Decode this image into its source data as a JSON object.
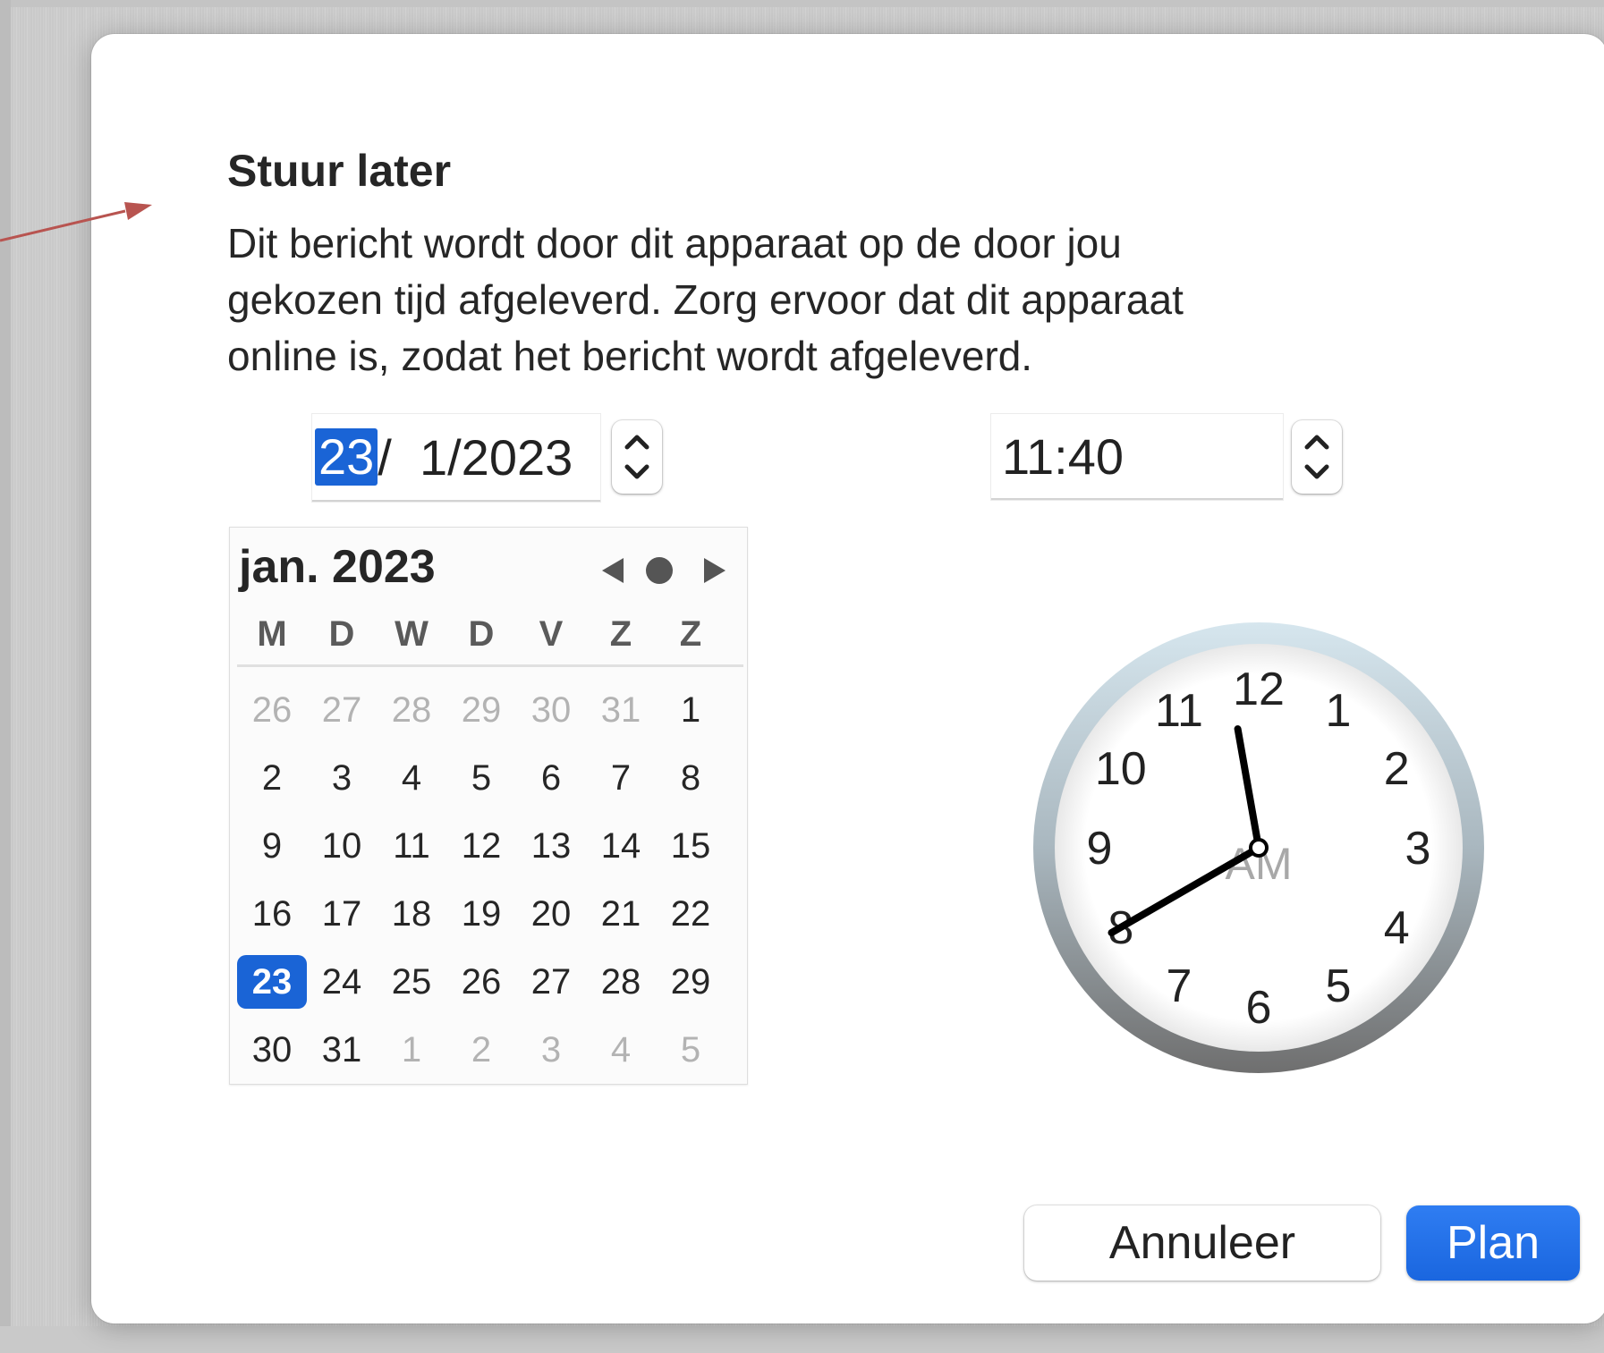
{
  "dialog": {
    "title": "Stuur later",
    "description_lines": [
      "Dit bericht wordt door dit apparaat op de door jou",
      "gekozen tijd afgeleverd. Zorg ervoor dat dit apparaat",
      "online is, zodat het bericht wordt afgeleverd."
    ]
  },
  "date_field": {
    "day": "23",
    "rest": "/  1/2023"
  },
  "time_field": {
    "value": "11:40"
  },
  "calendar": {
    "month_label": "jan. 2023",
    "weekdays": [
      "M",
      "D",
      "W",
      "D",
      "V",
      "Z",
      "Z"
    ],
    "weeks": [
      [
        {
          "d": "26",
          "dim": true
        },
        {
          "d": "27",
          "dim": true
        },
        {
          "d": "28",
          "dim": true
        },
        {
          "d": "29",
          "dim": true
        },
        {
          "d": "30",
          "dim": true
        },
        {
          "d": "31",
          "dim": true
        },
        {
          "d": "1"
        }
      ],
      [
        {
          "d": "2"
        },
        {
          "d": "3"
        },
        {
          "d": "4"
        },
        {
          "d": "5"
        },
        {
          "d": "6"
        },
        {
          "d": "7"
        },
        {
          "d": "8"
        }
      ],
      [
        {
          "d": "9"
        },
        {
          "d": "10"
        },
        {
          "d": "11"
        },
        {
          "d": "12"
        },
        {
          "d": "13"
        },
        {
          "d": "14"
        },
        {
          "d": "15"
        }
      ],
      [
        {
          "d": "16"
        },
        {
          "d": "17"
        },
        {
          "d": "18"
        },
        {
          "d": "19"
        },
        {
          "d": "20"
        },
        {
          "d": "21"
        },
        {
          "d": "22"
        }
      ],
      [
        {
          "d": "23",
          "selected": true
        },
        {
          "d": "24"
        },
        {
          "d": "25"
        },
        {
          "d": "26"
        },
        {
          "d": "27"
        },
        {
          "d": "28"
        },
        {
          "d": "29"
        }
      ],
      [
        {
          "d": "30"
        },
        {
          "d": "31"
        },
        {
          "d": "1",
          "dim": true
        },
        {
          "d": "2",
          "dim": true
        },
        {
          "d": "3",
          "dim": true
        },
        {
          "d": "4",
          "dim": true
        },
        {
          "d": "5",
          "dim": true
        }
      ]
    ],
    "nav_icons": [
      "chevron-left-icon",
      "today-dot-icon",
      "chevron-right-icon"
    ]
  },
  "clock": {
    "numerals": [
      "12",
      "1",
      "2",
      "3",
      "4",
      "5",
      "6",
      "7",
      "8",
      "9",
      "10",
      "11"
    ],
    "ampm": "AM",
    "hour": 11,
    "minute": 40
  },
  "buttons": {
    "cancel": "Annuleer",
    "plan": "Plan"
  },
  "colors": {
    "accent": "#1a64d6",
    "arrow": "#b85450"
  }
}
